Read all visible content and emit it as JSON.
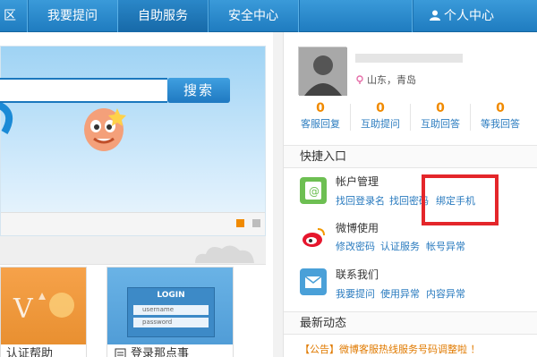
{
  "nav": {
    "item0": "区",
    "item1": "我要提问",
    "item2": "自助服务",
    "item3": "安全中心",
    "user_center": "个人中心"
  },
  "search": {
    "button": "搜索"
  },
  "cards": [
    {
      "label": "认证帮助"
    },
    {
      "label": "登录那点事",
      "login_title": "LOGIN",
      "username": "username",
      "password": "password"
    }
  ],
  "profile": {
    "location": "山东，青岛"
  },
  "stats": [
    {
      "value": "0",
      "label": "客服回复"
    },
    {
      "value": "0",
      "label": "互助提问"
    },
    {
      "value": "0",
      "label": "互助回答"
    },
    {
      "value": "0",
      "label": "等我回答"
    }
  ],
  "quick": {
    "title": "快捷入口",
    "groups": [
      {
        "heading": "帐户管理",
        "links": [
          "找回登录名",
          "找回密码",
          "绑定手机"
        ]
      },
      {
        "heading": "微博使用",
        "links": [
          "修改密码",
          "认证服务",
          "帐号异常"
        ]
      },
      {
        "heading": "联系我们",
        "links": [
          "我要提问",
          "使用异常",
          "内容异常"
        ]
      }
    ]
  },
  "news": {
    "title": "最新动态",
    "notice": "【公告】微博客服热线服务号码调整啦 ！"
  },
  "colors": {
    "nav": "#2b8ad0",
    "accent_orange": "#f08a00",
    "link_blue": "#2a7bbf",
    "highlight_red": "#e4262a"
  }
}
